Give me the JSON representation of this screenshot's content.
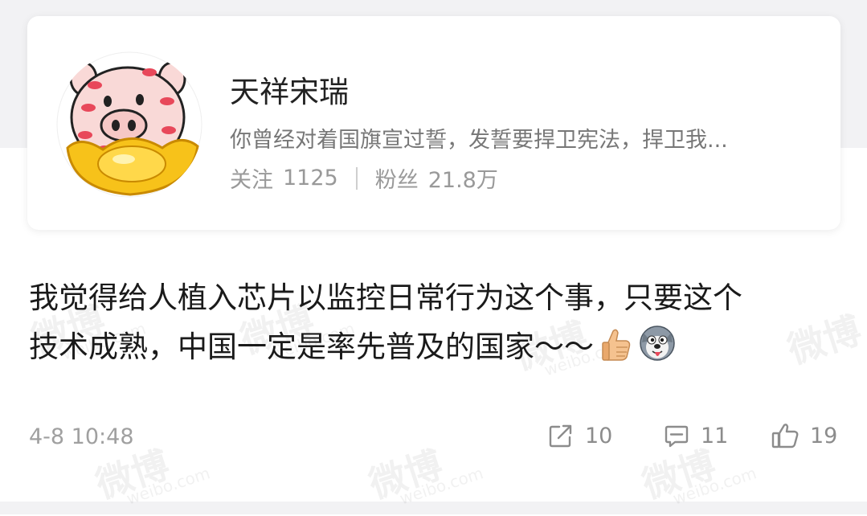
{
  "profile": {
    "name": "天祥宋瑞",
    "bio": "你曾经对着国旗宣过誓，发誓要捍卫宪法，捍卫我...",
    "following_label": "关注",
    "following_count": "1125",
    "followers_label": "粉丝",
    "followers_count": "21.8万"
  },
  "post": {
    "line1": "我觉得给人植入芯片以监控日常行为这个事，只要这个",
    "line2": "技术成熟，中国一定是率先普及的国家～～",
    "emojis": [
      "thumbs-up-icon",
      "dog-face-icon"
    ],
    "timestamp": "4-8 10:48",
    "share_count": "10",
    "comment_count": "11",
    "like_count": "19"
  },
  "watermark": {
    "cn": "微博",
    "en": "weibo.com"
  },
  "colors": {
    "text": "#1a1a1a",
    "secondary": "#777777",
    "muted": "#a0a0a0",
    "band": "#f2f2f4",
    "avatar_blush": "#e8485a",
    "avatar_yellow": "#f7c21a"
  }
}
